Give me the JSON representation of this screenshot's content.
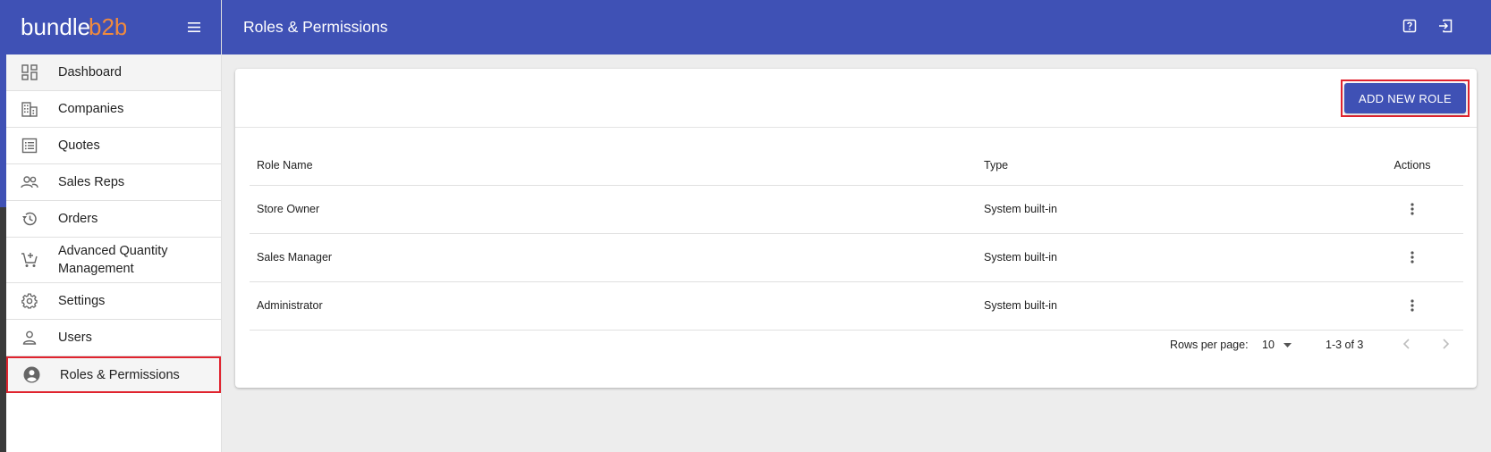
{
  "brand": {
    "name": "bundleb2b",
    "part1": "bundle",
    "part2": "b2b",
    "accent": "#f08a3e"
  },
  "colors": {
    "primary": "#3f51b5",
    "highlight": "#e0232e"
  },
  "header": {
    "title": "Roles & Permissions",
    "icons": [
      "help-icon",
      "logout-icon"
    ]
  },
  "sidebar": {
    "items": [
      {
        "label": "Dashboard",
        "icon": "dashboard-icon"
      },
      {
        "label": "Companies",
        "icon": "companies-icon"
      },
      {
        "label": "Quotes",
        "icon": "quotes-icon"
      },
      {
        "label": "Sales Reps",
        "icon": "sales-reps-icon"
      },
      {
        "label": "Orders",
        "icon": "orders-icon"
      },
      {
        "label": "Advanced Quantity Management",
        "icon": "cart-add-icon"
      },
      {
        "label": "Settings",
        "icon": "settings-icon"
      },
      {
        "label": "Users",
        "icon": "user-icon"
      },
      {
        "label": "Roles & Permissions",
        "icon": "account-circle-icon",
        "active": true
      }
    ]
  },
  "toolbar": {
    "add_label": "ADD NEW ROLE"
  },
  "table": {
    "columns": [
      "Role Name",
      "Type",
      "Actions"
    ],
    "rows": [
      {
        "name": "Store Owner",
        "type": "System built-in"
      },
      {
        "name": "Sales Manager",
        "type": "System built-in"
      },
      {
        "name": "Administrator",
        "type": "System built-in"
      }
    ]
  },
  "pagination": {
    "rows_per_page_label": "Rows per page:",
    "rows_per_page": "10",
    "range": "1-3 of 3"
  }
}
